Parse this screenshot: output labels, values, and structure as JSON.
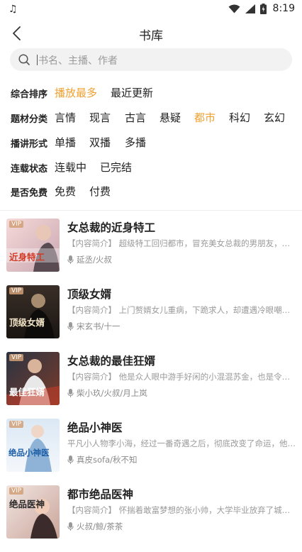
{
  "status_bar": {
    "time": "8:19",
    "colors": {
      "icons": "#333333"
    }
  },
  "header": {
    "title": "书库"
  },
  "search": {
    "placeholder": "书名、主播、作者"
  },
  "filters": [
    {
      "label": "综合排序",
      "options": [
        "播放最多",
        "最近更新"
      ],
      "selected": "播放最多"
    },
    {
      "label": "题材分类",
      "options": [
        "言情",
        "现言",
        "古言",
        "悬疑",
        "都市",
        "科幻",
        "玄幻"
      ],
      "selected": "都市"
    },
    {
      "label": "播讲形式",
      "options": [
        "单播",
        "双播",
        "多播"
      ],
      "selected": ""
    },
    {
      "label": "连载状态",
      "options": [
        "连载中",
        "已完结"
      ],
      "selected": ""
    },
    {
      "label": "是否免费",
      "options": [
        "免费",
        "付费"
      ],
      "selected": ""
    }
  ],
  "accent_color": "#f0a030",
  "books": [
    {
      "title": "女总裁的近身特工",
      "desc": "【内容简介】 超级特工回归都市，冒充美女总裁的男朋友，第…",
      "narrators": "延丞/火叔",
      "badge": "VIP",
      "cover_text": "近身特工"
    },
    {
      "title": "顶级女婿",
      "desc": "【内容简介】 上门赘婿女儿重病，下跪求人，却遭遇冷眼嘲讽…",
      "narrators": "宋玄书/十一",
      "badge": "VIP",
      "cover_text": "顶级女婿"
    },
    {
      "title": "女总裁的最佳狂婿",
      "desc": "【内容简介】 他是众人眼中游手好闲的小混混苏金，也是令全…",
      "narrators": "柴小玖/火叔/月上岚",
      "badge": "VIP",
      "cover_text": "最佳狂婿"
    },
    {
      "title": "绝品小神医",
      "desc": "平凡小人物李小海，经过一番奇遇之后，彻底改变了命运，他扳…",
      "narrators": "真皮sofa/秋不知",
      "badge": "VIP",
      "cover_text": "绝品小神医"
    },
    {
      "title": "都市绝品医神",
      "desc": "【内容简介】 怀揣着敢富梦想的张小帅，大学毕业放弃了城里…",
      "narrators": "火叔/鲸/茶茶",
      "badge": "VIP",
      "cover_text": "绝品医神"
    }
  ]
}
